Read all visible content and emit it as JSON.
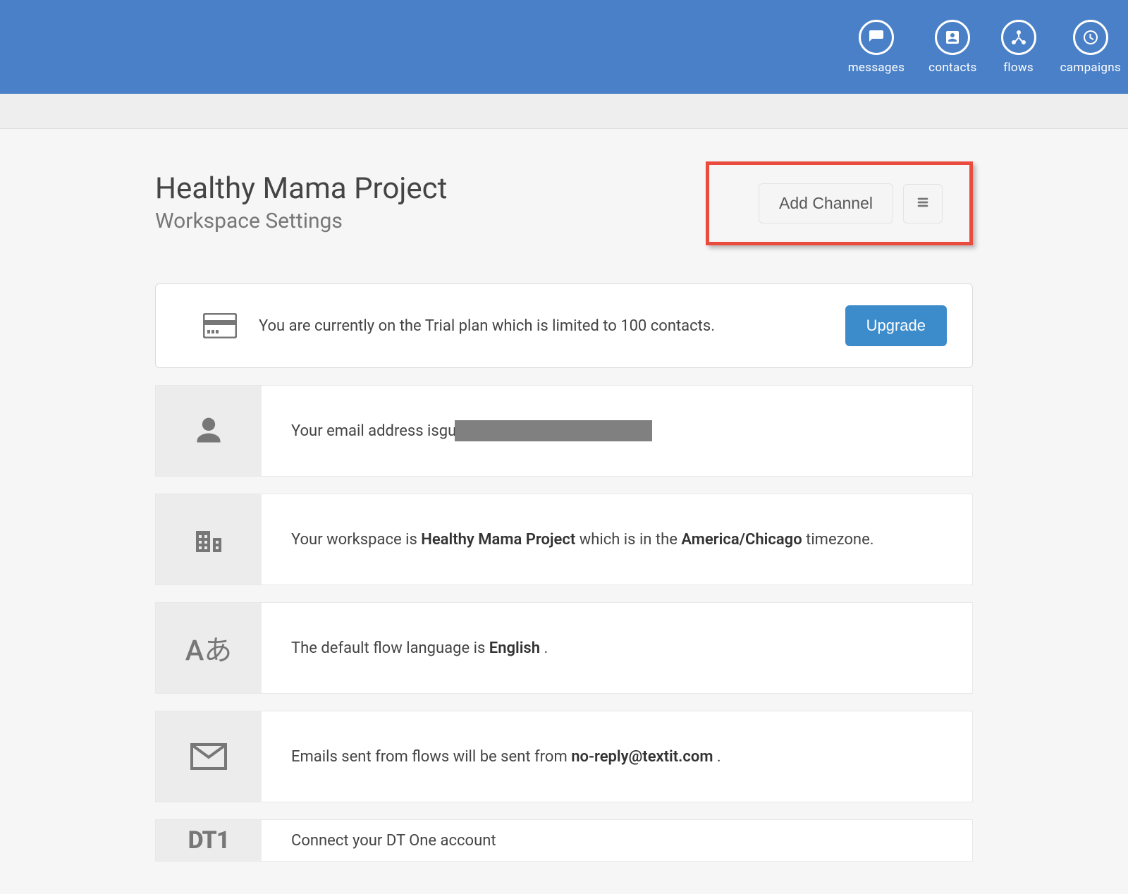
{
  "nav": {
    "items": [
      {
        "label": "messages"
      },
      {
        "label": "contacts"
      },
      {
        "label": "flows"
      },
      {
        "label": "campaigns"
      }
    ]
  },
  "header": {
    "title": "Healthy Mama Project",
    "subtitle": "Workspace Settings",
    "add_channel_label": "Add Channel"
  },
  "plan": {
    "text": "You are currently on the Trial plan which is limited to 100 contacts.",
    "upgrade_label": "Upgrade"
  },
  "settings": {
    "email_prefix": "Your email address is ",
    "email_visible": "gu",
    "workspace_pre": "Your workspace is ",
    "workspace_name": "Healthy Mama Project",
    "workspace_mid": " which is in the ",
    "workspace_tz": "America/Chicago",
    "workspace_post": " timezone.",
    "language_pre": "The default flow language is ",
    "language_value": "English",
    "language_post": ".",
    "flowemail_pre": "Emails sent from flows will be sent from ",
    "flowemail_value": "no-reply@textit.com",
    "flowemail_post": ".",
    "dtone_text": "Connect your DT One account",
    "dtone_label": "DT1"
  },
  "icons": {
    "lang_glyph": "Aあ"
  }
}
